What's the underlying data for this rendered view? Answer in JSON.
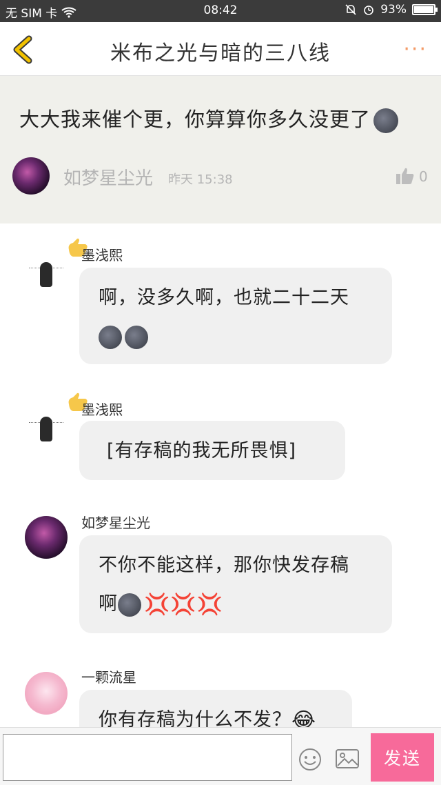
{
  "status_bar": {
    "sim": "无 SIM 卡",
    "time": "08:42",
    "battery": "93%",
    "battery_level": 0.93
  },
  "header": {
    "title": "米布之光与暗的三八线",
    "more_label": "···"
  },
  "post": {
    "text": "大大我来催个更，你算算你多久没更了",
    "author": "如梦星尘光",
    "time": "昨天 15:38",
    "like_count": "0"
  },
  "comments": [
    {
      "name": "墨浅熙",
      "text": "啊，没多久啊，也就二十二天",
      "emoji": [
        "moon",
        "moon"
      ]
    },
    {
      "name": "墨浅熙",
      "text": "[有存稿的我无所畏惧]",
      "emoji": []
    },
    {
      "name": "如梦星尘光",
      "text": "不你不能这样，那你快发存稿",
      "text2": "啊",
      "emoji": [
        "moon",
        "anger",
        "anger",
        "anger"
      ]
    },
    {
      "name": "一颗流星",
      "text": "你有存稿为什么不发？",
      "emoji": [
        "laugh"
      ]
    }
  ],
  "input_bar": {
    "placeholder": "",
    "send_label": "发送"
  },
  "icons": {
    "back": "chevron-left-icon",
    "like": "thumbs-up-icon",
    "emoji": "smiley-icon",
    "image": "image-icon",
    "accent": "#f76a9a",
    "back_color": "#f2c200"
  }
}
